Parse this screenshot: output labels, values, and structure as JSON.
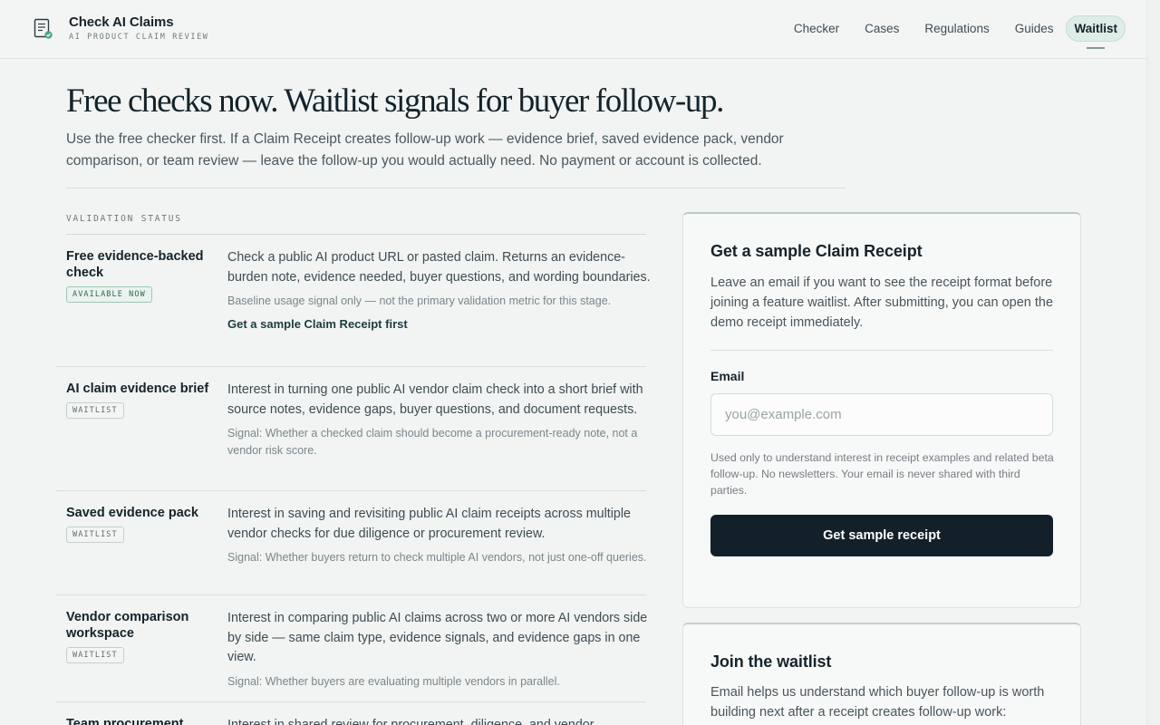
{
  "header": {
    "brand_name": "Check AI Claims",
    "brand_tagline": "AI PRODUCT CLAIM REVIEW",
    "nav": [
      {
        "label": "Checker",
        "active": false
      },
      {
        "label": "Cases",
        "active": false
      },
      {
        "label": "Regulations",
        "active": false
      },
      {
        "label": "Guides",
        "active": false
      },
      {
        "label": "Waitlist",
        "active": true
      }
    ]
  },
  "hero": {
    "title": "Free checks now. Waitlist signals for buyer follow-up.",
    "subtitle": "Use the free checker first. If a Claim Receipt creates follow-up work — evidence brief, saved evidence pack, vendor comparison, or team review — leave the follow-up you would actually need. No payment or account is collected."
  },
  "validation": {
    "section_label": "VALIDATION STATUS",
    "rows": [
      {
        "title": "Free evidence-backed check",
        "badge": "AVAILABLE NOW",
        "description": "Check a public AI product URL or pasted claim. Returns an evidence-burden note, evidence needed, buyer questions, and wording boundaries.",
        "signal": "Baseline usage signal only — not the primary validation metric for this stage.",
        "link": "Get a sample Claim Receipt first"
      },
      {
        "title": "AI claim evidence brief",
        "badge": "WAITLIST",
        "description": "Interest in turning one public AI vendor claim check into a short brief with source notes, evidence gaps, buyer questions, and document requests.",
        "signal": "Signal: Whether a checked claim should become a procurement-ready note, not a vendor risk score."
      },
      {
        "title": "Saved evidence pack",
        "badge": "WAITLIST",
        "description": "Interest in saving and revisiting public AI claim receipts across multiple vendor checks for due diligence or procurement review.",
        "signal": "Signal: Whether buyers return to check multiple AI vendors, not just one-off queries."
      },
      {
        "title": "Vendor comparison workspace",
        "badge": "WAITLIST",
        "description": "Interest in comparing public AI claims across two or more AI vendors side by side — same claim type, evidence signals, and evidence gaps in one view.",
        "signal": "Signal: Whether buyers are evaluating multiple vendors in parallel."
      },
      {
        "title": "Team procurement",
        "badge": "",
        "description": "Interest in shared review for procurement, diligence, and vendor",
        "signal": ""
      }
    ]
  },
  "sample_card": {
    "title": "Get a sample Claim Receipt",
    "text": "Leave an email if you want to see the receipt format before joining a feature waitlist. After submitting, you can open the demo receipt immediately.",
    "email_label": "Email",
    "email_placeholder": "you@example.com",
    "email_value": "",
    "fine_print": "Used only to understand interest in receipt examples and related beta follow-up. No newsletters. Your email is never shared with third parties.",
    "button_label": "Get sample receipt"
  },
  "waitlist_card": {
    "title": "Join the waitlist",
    "text": "Email helps us understand which buyer follow-up is worth building next after a receipt creates follow-up work:"
  },
  "colors": {
    "background": "#f1f4f3",
    "primary_button": "#13202a",
    "active_nav": "#deede7",
    "available_badge": "#2b6a50"
  }
}
